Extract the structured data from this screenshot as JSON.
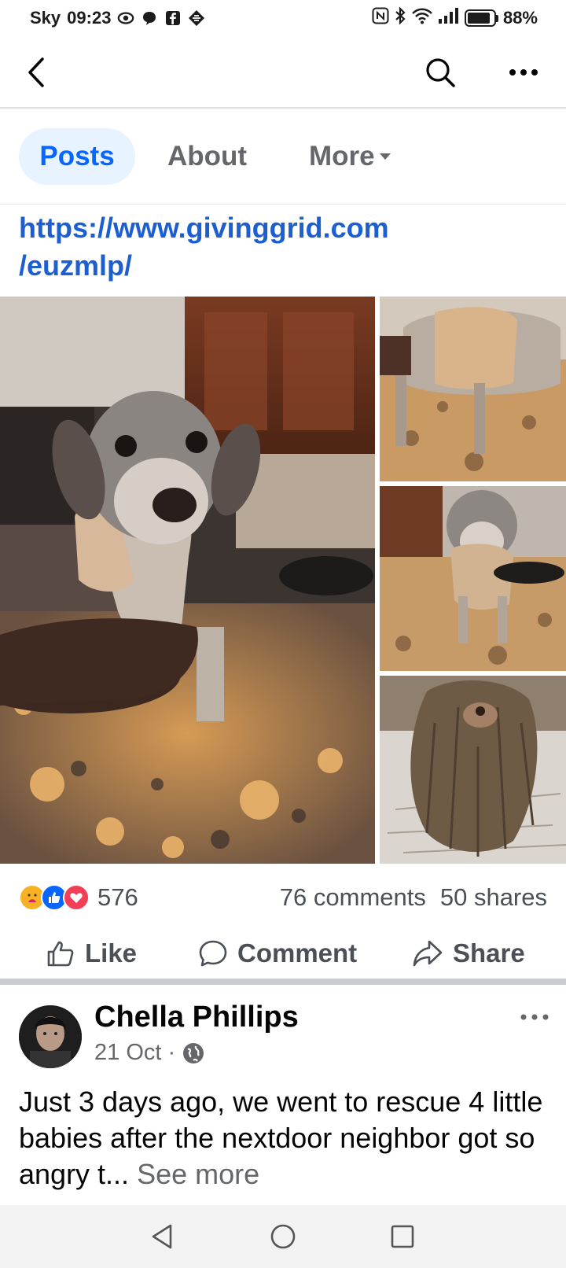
{
  "status_bar": {
    "carrier": "Sky",
    "time": "09:23",
    "battery": "88%",
    "battery_level": 0.88,
    "left_icons": [
      "eye-icon",
      "chat-bubble-icon",
      "facebook-icon",
      "app-icon"
    ],
    "right_icons": [
      "nfc-icon",
      "bluetooth-icon",
      "wifi-icon",
      "signal-icon",
      "battery-icon"
    ]
  },
  "top_nav": {
    "icons": [
      "back-icon",
      "search-icon",
      "more-icon"
    ]
  },
  "tabs": [
    {
      "label": "Posts",
      "active": true
    },
    {
      "label": "About",
      "active": false
    },
    {
      "label": "More",
      "active": false
    }
  ],
  "post": {
    "link_line1": "https://www.givinggrid.com",
    "link_line2": "/euzmlp/",
    "photos": [
      "dog-photo-main",
      "dog-photo-bandage",
      "dog-photo-standing",
      "dog-photo-matted"
    ],
    "reaction_icons": [
      "care-icon",
      "like-icon",
      "love-icon"
    ],
    "reaction_count": "576",
    "comments": "76 comments",
    "shares": "50 shares",
    "actions": {
      "like": "Like",
      "comment": "Comment",
      "share": "Share"
    }
  },
  "next_post": {
    "author": "Chella Phillips",
    "date": "21 Oct",
    "separator": "·",
    "privacy_icon": "globe-icon",
    "text": "Just 3 days ago, we went to rescue 4 little babies after the nextdoor neighbor got so angry t...",
    "see_more": "See more"
  },
  "colors": {
    "accent": "#0866ff",
    "link": "#1c5fd1",
    "tab_active_bg": "#e7f3ff",
    "secondary_text": "#65676b"
  },
  "android_nav": {
    "icons": [
      "nav-back-icon",
      "nav-home-icon",
      "nav-recent-icon"
    ]
  }
}
